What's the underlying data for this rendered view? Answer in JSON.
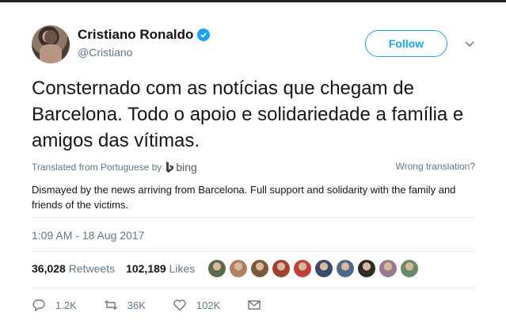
{
  "user": {
    "display_name": "Cristiano Ronaldo",
    "handle": "@Cristiano",
    "verified": true
  },
  "follow_button": {
    "label": "Follow"
  },
  "tweet": {
    "text": "Consternado com as notícias que chegam de Barcelona. Todo o apoio e solidariedade a família e amigos das vítimas.",
    "translated_from": "Translated from Portuguese by",
    "translator": "bing",
    "wrong_translation": "Wrong translation?",
    "translation": "Dismayed by the news arriving from Barcelona. Full support and solidarity with the family and friends of the victims.",
    "timestamp": "1:09 AM - 18 Aug 2017"
  },
  "stats": {
    "retweets_count": "36,028",
    "retweets_label": "Retweets",
    "likes_count": "102,189",
    "likes_label": "Likes"
  },
  "likers": [
    {
      "color": "#5a6b4a"
    },
    {
      "color": "#b08060"
    },
    {
      "color": "#7a5a3a"
    },
    {
      "color": "#a04030"
    },
    {
      "color": "#c04040"
    },
    {
      "color": "#3a4a6a"
    },
    {
      "color": "#4a6a8a"
    },
    {
      "color": "#2a2a2a"
    },
    {
      "color": "#9a7a90"
    },
    {
      "color": "#6a8a6a"
    }
  ],
  "actions": {
    "replies": "1.2K",
    "retweets": "36K",
    "likes": "102K"
  },
  "colors": {
    "accent": "#1da1f2",
    "secondary_text": "#657786",
    "divider": "#e6ecf0"
  }
}
